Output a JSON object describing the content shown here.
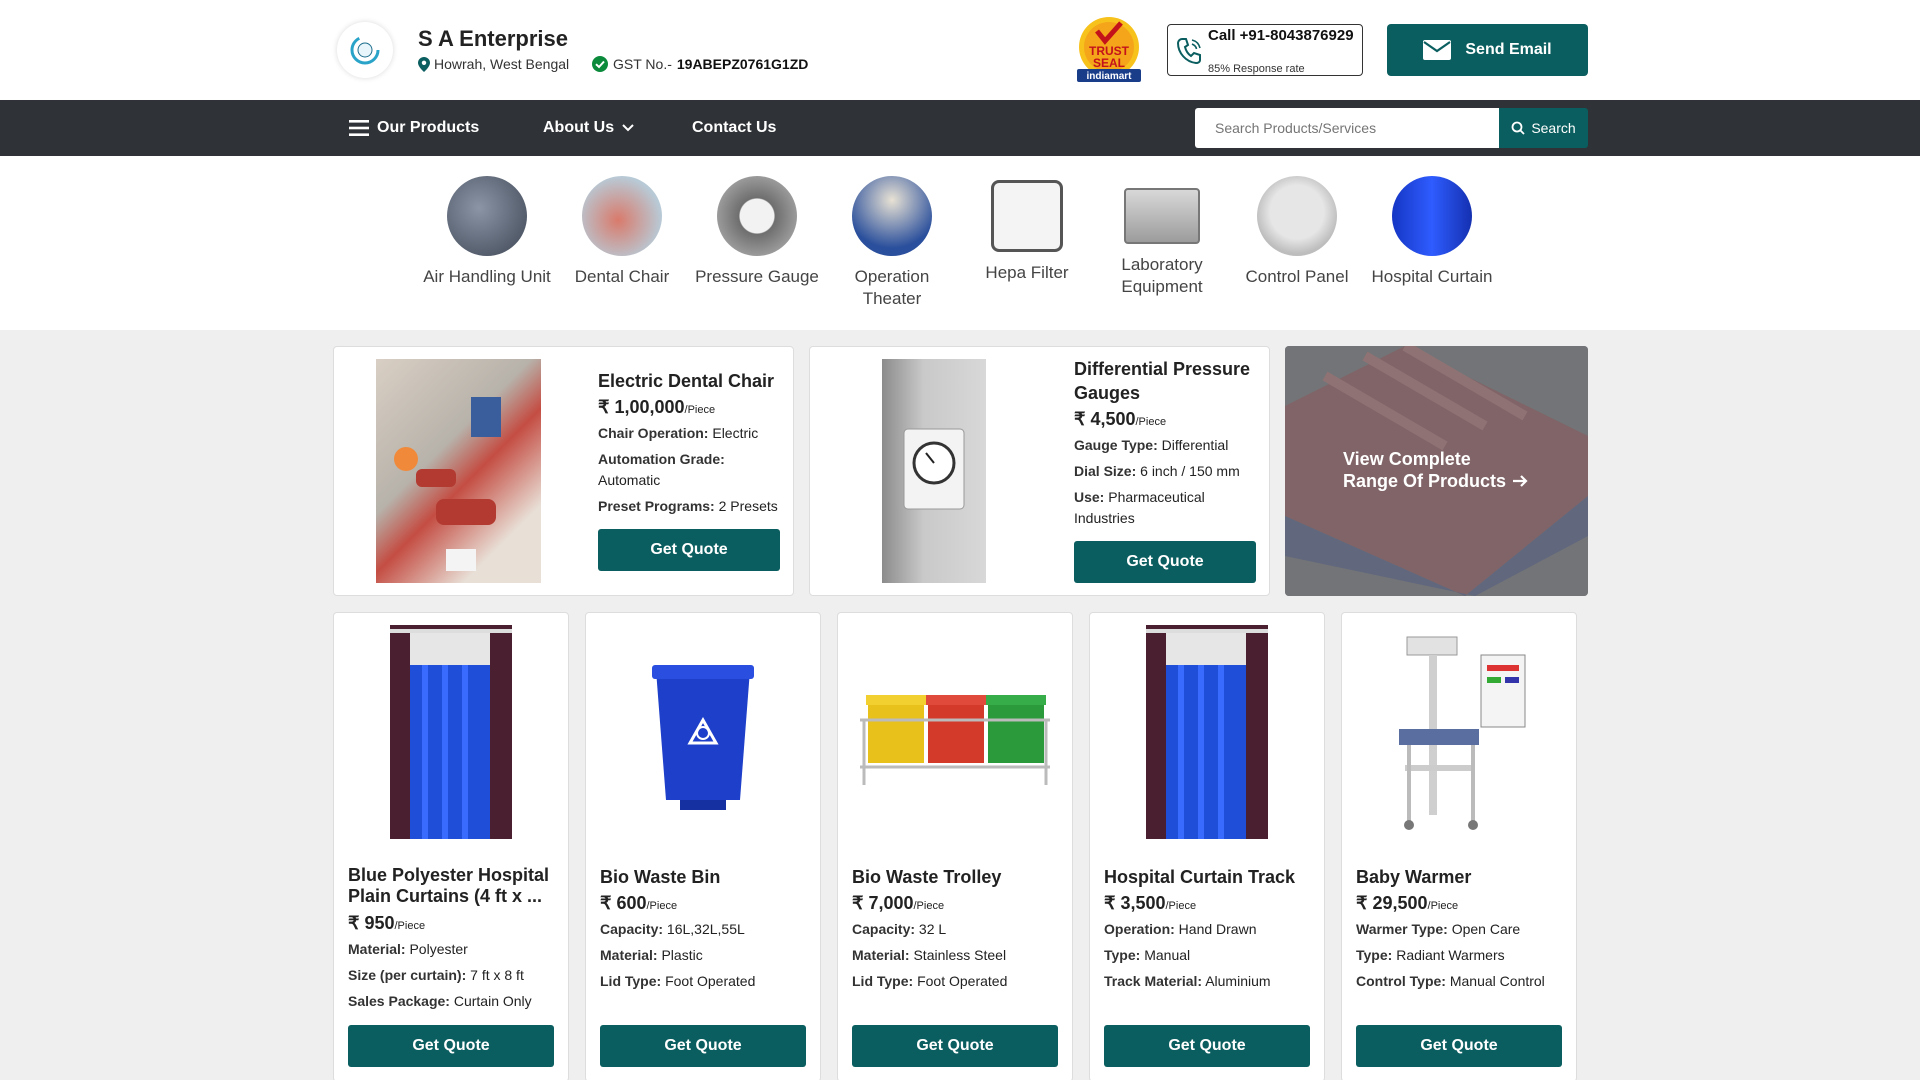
{
  "header": {
    "company_name": "S A Enterprise",
    "location": "Howrah, West Bengal",
    "gst_label": "GST No.-",
    "gst_number": "19ABEPZ0761G1ZD",
    "trust_seal": [
      "TRUST",
      "SEAL",
      "indiamart"
    ],
    "call_label": "Call +91-8043876929",
    "response_rate": "85% Response rate",
    "email_button": "Send Email"
  },
  "nav": {
    "products": "Our Products",
    "about": "About Us",
    "contact": "Contact Us",
    "search_placeholder": "Search Products/Services",
    "search_button": "Search"
  },
  "categories": [
    {
      "label": "Air Handling Unit"
    },
    {
      "label": "Dental Chair"
    },
    {
      "label": "Pressure Gauge"
    },
    {
      "label": "Operation Theater"
    },
    {
      "label": "Hepa Filter"
    },
    {
      "label": "Laboratory Equipment"
    },
    {
      "label": "Control Panel"
    },
    {
      "label": "Hospital Curtain"
    }
  ],
  "featured": [
    {
      "title": "Electric Dental Chair",
      "price": "₹ 1,00,000",
      "unit": "/Piece",
      "attrs": [
        {
          "k": "Chair Operation:",
          "v": "Electric"
        },
        {
          "k": "Automation Grade:",
          "v": "Automatic"
        },
        {
          "k": "Preset Programs:",
          "v": "2 Presets"
        }
      ],
      "button": "Get Quote"
    },
    {
      "title": "Differential Pressure Gauges",
      "price": "₹ 4,500",
      "unit": "/Piece",
      "attrs": [
        {
          "k": "Gauge Type:",
          "v": "Differential"
        },
        {
          "k": "Dial Size:",
          "v": "6 inch / 150 mm"
        },
        {
          "k": "Use:",
          "v": "Pharmaceutical Industries"
        }
      ],
      "button": "Get Quote"
    }
  ],
  "view_all": {
    "line1": "View Complete",
    "line2": "Range Of Products"
  },
  "products": [
    {
      "title": "Blue Polyester Hospital Plain Curtains (4 ft x ...",
      "price": "₹ 950",
      "unit": "/Piece",
      "attrs": [
        {
          "k": "Material:",
          "v": "Polyester"
        },
        {
          "k": "Size (per curtain):",
          "v": "7 ft x 8 ft"
        },
        {
          "k": "Sales Package:",
          "v": "Curtain Only"
        }
      ],
      "button": "Get Quote"
    },
    {
      "title": "Bio Waste Bin",
      "price": "₹ 600",
      "unit": "/Piece",
      "attrs": [
        {
          "k": "Capacity:",
          "v": "16L,32L,55L"
        },
        {
          "k": "Material:",
          "v": "Plastic"
        },
        {
          "k": "Lid Type:",
          "v": "Foot Operated"
        }
      ],
      "button": "Get Quote"
    },
    {
      "title": "Bio Waste Trolley",
      "price": "₹ 7,000",
      "unit": "/Piece",
      "attrs": [
        {
          "k": "Capacity:",
          "v": "32 L"
        },
        {
          "k": "Material:",
          "v": "Stainless Steel"
        },
        {
          "k": "Lid Type:",
          "v": "Foot Operated"
        }
      ],
      "button": "Get Quote"
    },
    {
      "title": "Hospital Curtain Track",
      "price": "₹ 3,500",
      "unit": "/Piece",
      "attrs": [
        {
          "k": "Operation:",
          "v": "Hand Drawn"
        },
        {
          "k": "Type:",
          "v": "Manual"
        },
        {
          "k": "Track Material:",
          "v": "Aluminium"
        }
      ],
      "button": "Get Quote"
    },
    {
      "title": "Baby Warmer",
      "price": "₹ 29,500",
      "unit": "/Piece",
      "attrs": [
        {
          "k": "Warmer Type:",
          "v": "Open Care"
        },
        {
          "k": "Type:",
          "v": "Radiant Warmers"
        },
        {
          "k": "Control Type:",
          "v": "Manual Control"
        }
      ],
      "button": "Get Quote"
    }
  ],
  "colors": {
    "primary": "#0b5e5f",
    "nav": "#2f3236"
  }
}
